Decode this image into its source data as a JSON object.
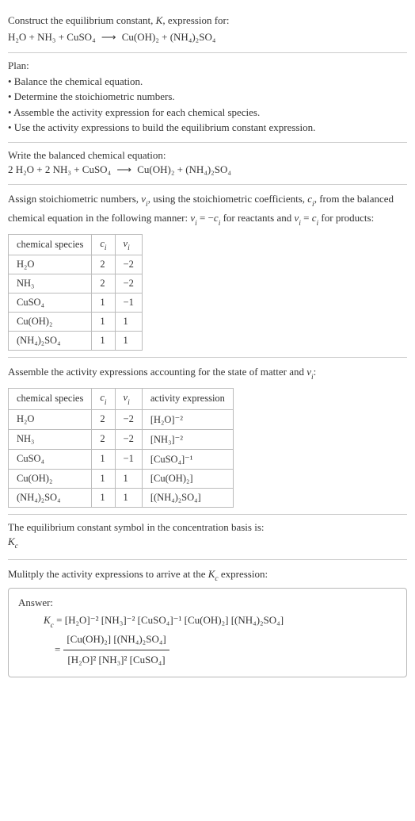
{
  "s1": {
    "line1": "Construct the equilibrium constant, ",
    "Kital": "K",
    "line1b": ", expression for:",
    "eq_left": "H₂O + NH₃ + CuSO₄",
    "arrow": "⟶",
    "eq_right": "Cu(OH)₂ + (NH₄)₂SO₄"
  },
  "s2": {
    "heading": "Plan:",
    "bullets": [
      "• Balance the chemical equation.",
      "• Determine the stoichiometric numbers.",
      "• Assemble the activity expression for each chemical species.",
      "• Use the activity expressions to build the equilibrium constant expression."
    ]
  },
  "s3": {
    "heading": "Write the balanced chemical equation:",
    "eq_left": "2 H₂O + 2 NH₃ + CuSO₄",
    "arrow": "⟶",
    "eq_right": "Cu(OH)₂ + (NH₄)₂SO₄"
  },
  "s4": {
    "text_a": "Assign stoichiometric numbers, ",
    "nu": "ν",
    "sub_i": "i",
    "text_b": ", using the stoichiometric coefficients, ",
    "c": "c",
    "text_c": ", from the balanced chemical equation in the following manner: ",
    "rel1_lhs": "ν",
    "rel1_eq": " = −",
    "rel1_rhs": "c",
    "text_d": " for reactants and ",
    "rel2_lhs": "ν",
    "rel2_eq": " = ",
    "rel2_rhs": "c",
    "text_e": " for products:",
    "headers": [
      "chemical species",
      "cᵢ",
      "νᵢ"
    ],
    "rows": [
      {
        "sp": "H₂O",
        "c": "2",
        "v": "−2"
      },
      {
        "sp": "NH₃",
        "c": "2",
        "v": "−2"
      },
      {
        "sp": "CuSO₄",
        "c": "1",
        "v": "−1"
      },
      {
        "sp": "Cu(OH)₂",
        "c": "1",
        "v": "1"
      },
      {
        "sp": "(NH₄)₂SO₄",
        "c": "1",
        "v": "1"
      }
    ]
  },
  "s5": {
    "text_a": "Assemble the activity expressions accounting for the state of matter and ",
    "nu": "ν",
    "sub_i": "i",
    "colon": ":",
    "headers": [
      "chemical species",
      "cᵢ",
      "νᵢ",
      "activity expression"
    ],
    "rows": [
      {
        "sp": "H₂O",
        "c": "2",
        "v": "−2",
        "a": "[H₂O]⁻²"
      },
      {
        "sp": "NH₃",
        "c": "2",
        "v": "−2",
        "a": "[NH₃]⁻²"
      },
      {
        "sp": "CuSO₄",
        "c": "1",
        "v": "−1",
        "a": "[CuSO₄]⁻¹"
      },
      {
        "sp": "Cu(OH)₂",
        "c": "1",
        "v": "1",
        "a": "[Cu(OH)₂]"
      },
      {
        "sp": "(NH₄)₂SO₄",
        "c": "1",
        "v": "1",
        "a": "[(NH₄)₂SO₄]"
      }
    ]
  },
  "s6": {
    "text": "The equilibrium constant symbol in the concentration basis is:",
    "K": "K",
    "c": "c"
  },
  "s7": {
    "text_a": "Mulitply the activity expressions to arrive at the ",
    "K": "K",
    "c": "c",
    "text_b": " expression:",
    "answer_label": "Answer:",
    "eq_lhs_K": "K",
    "eq_lhs_c": "c",
    "eq_eq": " = ",
    "eq_rhs1": "[H₂O]⁻² [NH₃]⁻² [CuSO₄]⁻¹ [Cu(OH)₂] [(NH₄)₂SO₄]",
    "eq_eq2": "= ",
    "frac_num": "[Cu(OH)₂] [(NH₄)₂SO₄]",
    "frac_den": "[H₂O]² [NH₃]² [CuSO₄]"
  },
  "chart_data": {
    "type": "table",
    "tables": [
      {
        "title": "Stoichiometric numbers",
        "columns": [
          "chemical species",
          "c_i",
          "ν_i"
        ],
        "rows": [
          [
            "H2O",
            2,
            -2
          ],
          [
            "NH3",
            2,
            -2
          ],
          [
            "CuSO4",
            1,
            -1
          ],
          [
            "Cu(OH)2",
            1,
            1
          ],
          [
            "(NH4)2SO4",
            1,
            1
          ]
        ]
      },
      {
        "title": "Activity expressions",
        "columns": [
          "chemical species",
          "c_i",
          "ν_i",
          "activity expression"
        ],
        "rows": [
          [
            "H2O",
            2,
            -2,
            "[H2O]^-2"
          ],
          [
            "NH3",
            2,
            -2,
            "[NH3]^-2"
          ],
          [
            "CuSO4",
            1,
            -1,
            "[CuSO4]^-1"
          ],
          [
            "Cu(OH)2",
            1,
            1,
            "[Cu(OH)2]"
          ],
          [
            "(NH4)2SO4",
            1,
            1,
            "[(NH4)2SO4]"
          ]
        ]
      }
    ]
  }
}
